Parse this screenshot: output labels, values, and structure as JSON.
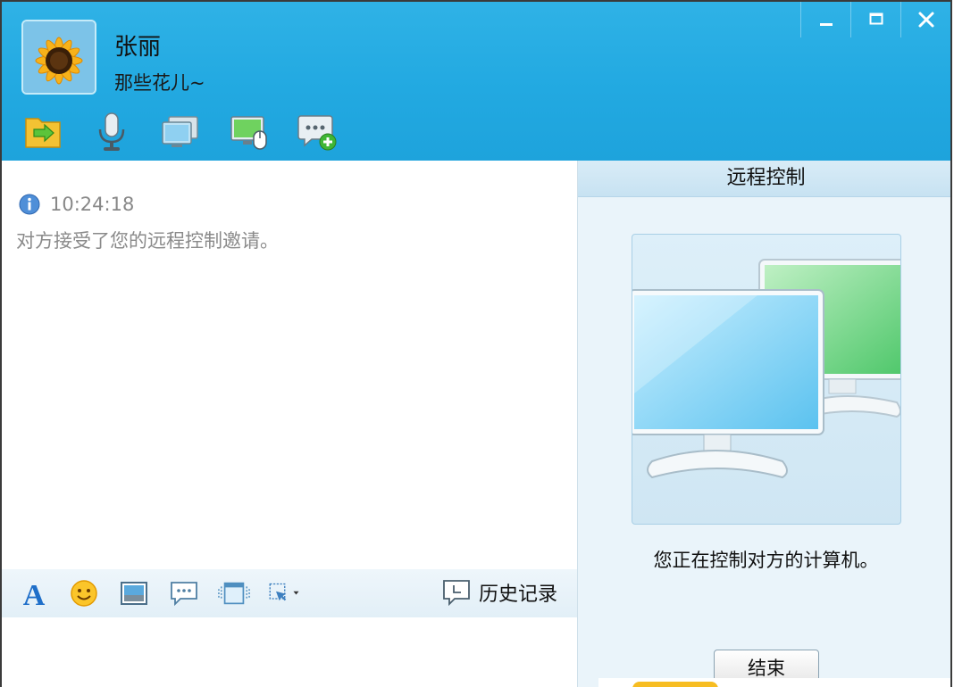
{
  "contact": {
    "name": "张丽",
    "signature": "那些花儿~"
  },
  "window_controls": [
    "minimize-icon",
    "maximize-icon",
    "close-icon"
  ],
  "toolbar_icons": [
    "file-transfer-icon",
    "microphone-icon",
    "video-icon",
    "remote-desktop-icon",
    "add-chat-icon"
  ],
  "chat": {
    "message": {
      "time": "10:24:18",
      "text": "对方接受了您的远程控制邀请。"
    }
  },
  "input_toolbar": {
    "icons": [
      "font-icon",
      "emoji-icon",
      "image-icon",
      "bubble-icon",
      "window-shake-icon",
      "screenshot-icon"
    ],
    "history_label": "历史记录"
  },
  "panel": {
    "title": "远程控制",
    "status": "您正在控制对方的计算机。",
    "end_button": "结束"
  },
  "colors": {
    "header": "#22a9e1",
    "panel_bg": "#eaf4fa",
    "input_toolbar_bg": "#e6f1f8"
  }
}
